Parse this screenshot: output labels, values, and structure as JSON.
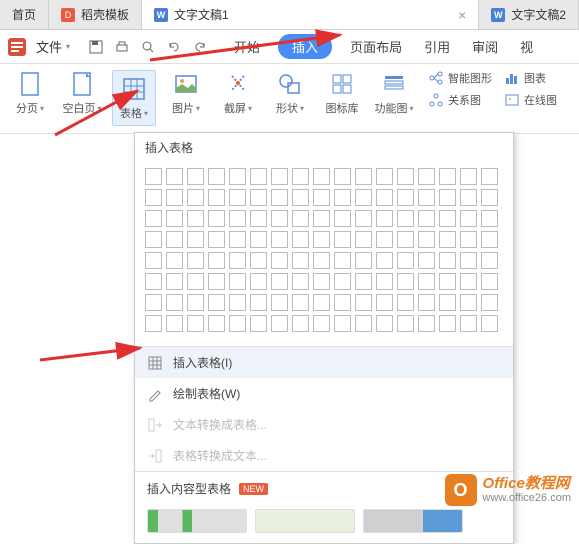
{
  "tabs": {
    "home": "首页",
    "daoke": "稻壳模板",
    "doc1": "文字文稿1",
    "doc2": "文字文稿2"
  },
  "fileMenu": "文件",
  "menuTabs": {
    "start": "开始",
    "insert": "插入",
    "pageLayout": "页面布局",
    "reference": "引用",
    "review": "审阅",
    "view": "视"
  },
  "ribbon": {
    "pageBreak": "分页",
    "blankPage": "空白页",
    "table": "表格",
    "picture": "图片",
    "screenshot": "截屏",
    "shapes": "形状",
    "iconLib": "图标库",
    "funcChart": "功能图",
    "smartArt": "智能图形",
    "chart": "图表",
    "relation": "关系图",
    "onlinePic": "在线图"
  },
  "dropdown": {
    "header": "插入表格",
    "insertTable": "插入表格(I)",
    "drawTable": "绘制表格(W)",
    "textToTable": "文本转换成表格...",
    "tableToText": "表格转换成文本...",
    "contentTypeTable": "插入内容型表格",
    "newBadge": "NEW"
  },
  "watermark": {
    "title": "Office教程网",
    "url": "www.office26.com"
  }
}
